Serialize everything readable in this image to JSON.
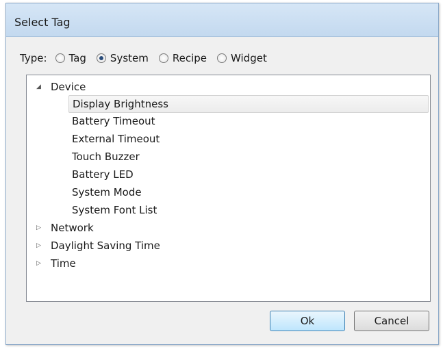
{
  "dialog": {
    "title": "Select Tag"
  },
  "type_selector": {
    "label": "Type:",
    "options": [
      {
        "label": "Tag",
        "selected": false
      },
      {
        "label": "System",
        "selected": true
      },
      {
        "label": "Recipe",
        "selected": false
      },
      {
        "label": "Widget",
        "selected": false
      }
    ]
  },
  "tree": {
    "device": {
      "label": "Device",
      "expanded": true,
      "children": [
        "Display Brightness",
        "Battery Timeout",
        "External Timeout",
        "Touch Buzzer",
        "Battery LED",
        "System Mode",
        "System Font List"
      ],
      "selected_child": "Display Brightness"
    },
    "collapsed_nodes": [
      "Network",
      "Daylight Saving Time",
      "Time"
    ],
    "icons": {
      "expanded": "triangle-down-icon",
      "collapsed": "triangle-right-icon"
    }
  },
  "buttons": {
    "ok": "Ok",
    "cancel": "Cancel"
  },
  "colors": {
    "titlebar": "#c3d9ef",
    "selection": "#ececec",
    "ok_border": "#3c7fb1"
  }
}
